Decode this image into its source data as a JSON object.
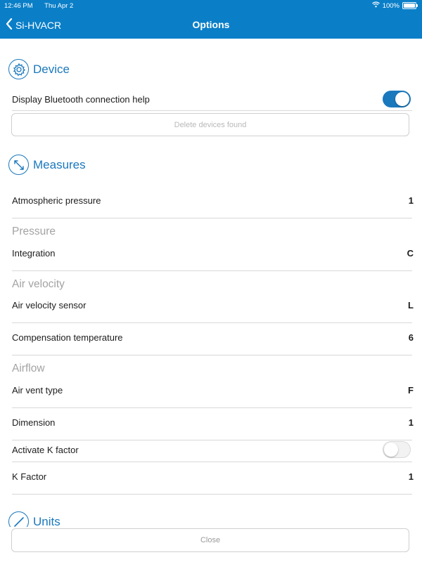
{
  "status_bar": {
    "time": "12:46 PM",
    "date": "Thu Apr 2",
    "battery": "100%"
  },
  "nav": {
    "back_label": "Si-HVACR",
    "title": "Options"
  },
  "device": {
    "title": "Device",
    "bluetooth_help_label": "Display Bluetooth connection help",
    "bluetooth_help_on": true,
    "delete_devices_button": "Delete devices found"
  },
  "measures": {
    "title": "Measures",
    "atmospheric_pressure": {
      "label": "Atmospheric pressure",
      "value": "1"
    },
    "pressure_group": "Pressure",
    "integration": {
      "label": "Integration",
      "value": "C"
    },
    "air_velocity_group": "Air velocity",
    "air_velocity_sensor": {
      "label": "Air velocity sensor",
      "value": "L"
    },
    "compensation_temperature": {
      "label": "Compensation temperature",
      "value": "6"
    },
    "airflow_group": "Airflow",
    "air_vent_type": {
      "label": "Air vent type",
      "value": "F"
    },
    "dimension": {
      "label": "Dimension",
      "value": "1"
    },
    "activate_k_factor": {
      "label": "Activate K factor",
      "on": false
    },
    "k_factor": {
      "label": "K Factor",
      "value": "1"
    }
  },
  "units": {
    "title": "Units"
  },
  "close_button": "Close",
  "colors": {
    "accent": "#0a7fc8",
    "section": "#1a78bd"
  }
}
